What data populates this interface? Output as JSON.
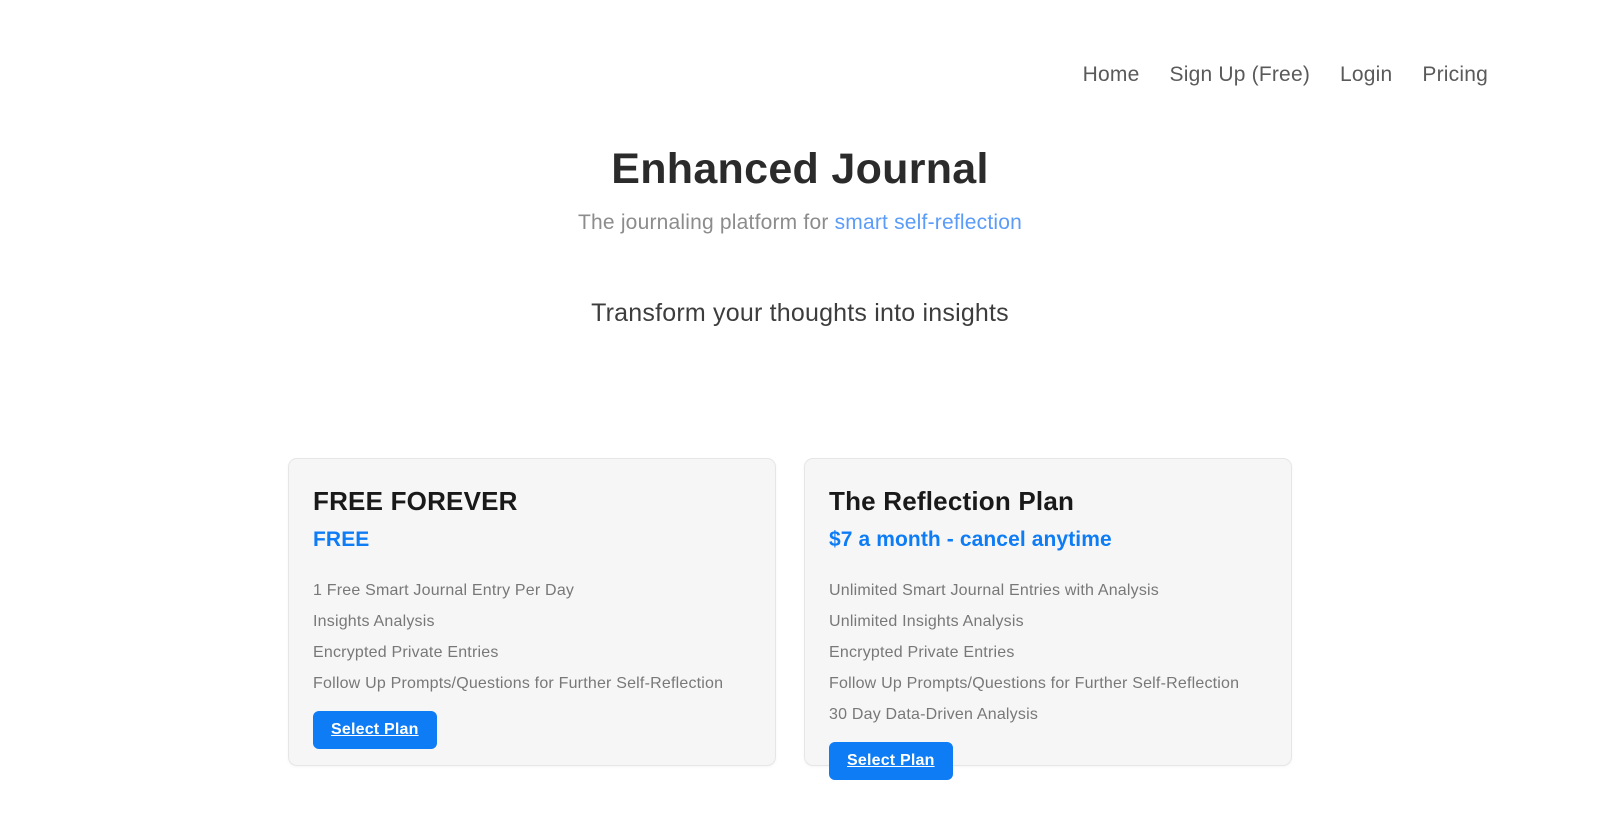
{
  "nav": {
    "items": [
      {
        "label": "Home"
      },
      {
        "label": "Sign Up (Free)"
      },
      {
        "label": "Login"
      },
      {
        "label": "Pricing"
      }
    ]
  },
  "hero": {
    "title": "Enhanced Journal",
    "subtitle_prefix": "The journaling platform for ",
    "subtitle_accent": "smart self-reflection"
  },
  "tagline": "Transform your thoughts into insights",
  "pricing": {
    "plans": [
      {
        "name": "FREE FOREVER",
        "price": "FREE",
        "features": [
          "1 Free Smart Journal Entry Per Day",
          "Insights Analysis",
          "Encrypted Private Entries",
          "Follow Up Prompts/Questions for Further Self-Reflection"
        ],
        "cta": "Select Plan"
      },
      {
        "name": "The Reflection Plan",
        "price": "$7 a month - cancel anytime",
        "features": [
          "Unlimited Smart Journal Entries with Analysis",
          "Unlimited Insights Analysis",
          "Encrypted Private Entries",
          "Follow Up Prompts/Questions for Further Self-Reflection",
          "30 Day Data-Driven Analysis"
        ],
        "cta": "Select Plan"
      }
    ]
  },
  "colors": {
    "accent_blue": "#0d7cf5",
    "link_blue": "#5a9cf8",
    "card_bg": "#f6f6f6",
    "card_border": "#e6e6e6",
    "page_bg": "#ffffff"
  }
}
